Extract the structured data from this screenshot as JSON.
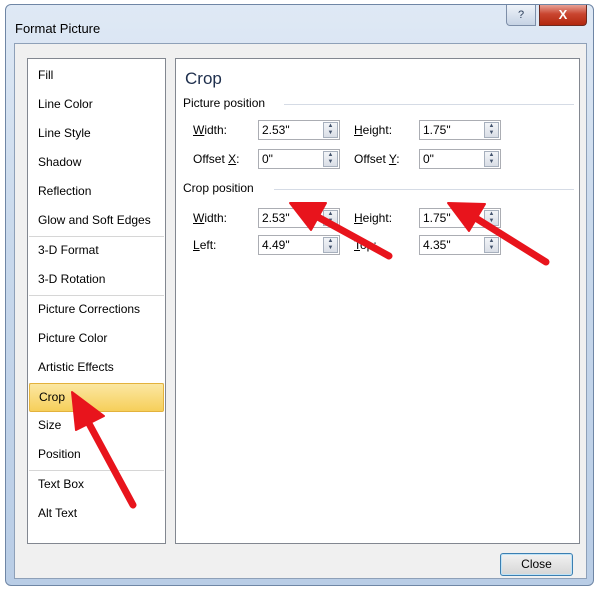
{
  "window": {
    "title": "Format Picture",
    "help_label": "?",
    "close_label": "X"
  },
  "nav": {
    "items": [
      {
        "label": "Fill"
      },
      {
        "label": "Line Color"
      },
      {
        "label": "Line Style"
      },
      {
        "label": "Shadow"
      },
      {
        "label": "Reflection"
      },
      {
        "label": "Glow and Soft Edges"
      },
      {
        "label": "3-D Format"
      },
      {
        "label": "3-D Rotation"
      },
      {
        "label": "Picture Corrections"
      },
      {
        "label": "Picture Color"
      },
      {
        "label": "Artistic Effects"
      },
      {
        "label": "Crop"
      },
      {
        "label": "Size"
      },
      {
        "label": "Position"
      },
      {
        "label": "Text Box"
      },
      {
        "label": "Alt Text"
      }
    ],
    "selected": "Crop"
  },
  "panel": {
    "heading": "Crop",
    "picture_position": {
      "label": "Picture position",
      "width": {
        "label_u": "W",
        "label_rest": "idth:",
        "value": "2.53\""
      },
      "height": {
        "label_u": "H",
        "label_rest": "eight:",
        "value": "1.75\""
      },
      "offset_x": {
        "label_pre": "Offset ",
        "label_u": "X",
        "label_rest": ":",
        "value": "0\""
      },
      "offset_y": {
        "label_pre": "Offset ",
        "label_u": "Y",
        "label_rest": ":",
        "value": "0\""
      }
    },
    "crop_position": {
      "label": "Crop position",
      "width": {
        "label_u": "W",
        "label_rest": "idth:",
        "value": "2.53\""
      },
      "height": {
        "label_u": "H",
        "label_rest": "eight:",
        "value": "1.75\""
      },
      "left": {
        "label_u": "L",
        "label_rest": "eft:",
        "value": "4.49\""
      },
      "top": {
        "label_u": "T",
        "label_rest": "op:",
        "value": "4.35\""
      }
    }
  },
  "footer": {
    "close_label": "Close"
  },
  "colors": {
    "accent_selected": "#f6cf5a",
    "annotation_arrow": "#e8141c"
  },
  "spin_up_glyph": "▲",
  "spin_down_glyph": "▼"
}
